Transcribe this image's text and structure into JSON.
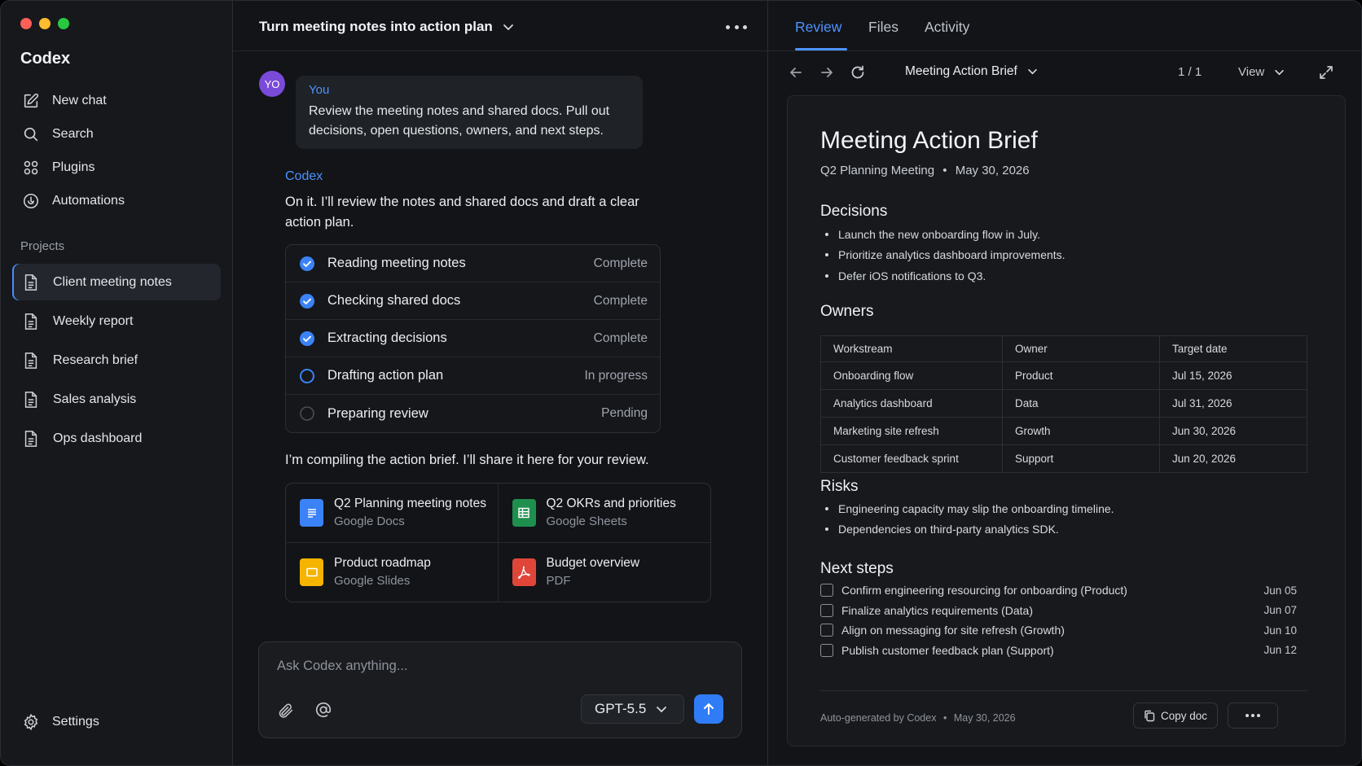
{
  "app": {
    "title": "Codex"
  },
  "sidebar": {
    "nav": [
      {
        "label": "New chat",
        "icon": "edit-icon"
      },
      {
        "label": "Search",
        "icon": "search-icon"
      },
      {
        "label": "Plugins",
        "icon": "plugins-icon"
      },
      {
        "label": "Automations",
        "icon": "automations-icon"
      }
    ],
    "projects_label": "Projects",
    "projects": [
      {
        "label": "Client meeting notes",
        "active": true
      },
      {
        "label": "Weekly report"
      },
      {
        "label": "Research brief"
      },
      {
        "label": "Sales analysis"
      },
      {
        "label": "Ops dashboard"
      }
    ],
    "settings_label": "Settings"
  },
  "chat": {
    "title": "Turn meeting notes into action plan",
    "user": {
      "avatar": "YO",
      "name": "You",
      "message": "Review the meeting notes and shared docs. Pull out decisions, open questions, owners, and next steps."
    },
    "assistant": {
      "name": "Codex",
      "message": "On it. I’ll review the notes and shared docs and draft a clear action plan.",
      "tasks": [
        {
          "label": "Reading meeting notes",
          "status": "Complete"
        },
        {
          "label": "Checking shared docs",
          "status": "Complete"
        },
        {
          "label": "Extracting decisions",
          "status": "Complete"
        },
        {
          "label": "Drafting action plan",
          "status": "In progress"
        },
        {
          "label": "Preparing review",
          "status": "Pending"
        }
      ],
      "followup": "I’m compiling the action brief. I’ll share it here for your review.",
      "attachments": [
        {
          "name": "Q2 Planning meeting notes",
          "source": "Google Docs",
          "color": "#3b82f6"
        },
        {
          "name": "Q2 OKRs and priorities",
          "source": "Google Sheets",
          "color": "#1f8f4e"
        },
        {
          "name": "Product roadmap",
          "source": "Google Slides",
          "color": "#f4b400"
        },
        {
          "name": "Budget overview",
          "source": "PDF",
          "color": "#e0453a"
        }
      ]
    },
    "composer": {
      "placeholder": "Ask Codex anything...",
      "model": "GPT-5.5"
    }
  },
  "panel": {
    "tabs": [
      "Review",
      "Files",
      "Activity"
    ],
    "active_tab": "Review",
    "doc_selector": "Meeting Action Brief",
    "pager": "1 / 1",
    "view_label": "View",
    "doc": {
      "title": "Meeting Action Brief",
      "subtitle_meeting": "Q2 Planning Meeting",
      "subtitle_date": "May 30, 2026",
      "decisions_heading": "Decisions",
      "decisions": [
        "Launch the new onboarding flow in July.",
        "Prioritize analytics dashboard improvements.",
        "Defer iOS notifications to Q3."
      ],
      "owners_heading": "Owners",
      "owners_columns": [
        "Workstream",
        "Owner",
        "Target date"
      ],
      "owners_rows": [
        [
          "Onboarding flow",
          "Product",
          "Jul 15, 2026"
        ],
        [
          "Analytics dashboard",
          "Data",
          "Jul 31, 2026"
        ],
        [
          "Marketing site refresh",
          "Growth",
          "Jun 30, 2026"
        ],
        [
          "Customer feedback sprint",
          "Support",
          "Jun 20, 2026"
        ]
      ],
      "risks_heading": "Risks",
      "risks": [
        "Engineering capacity may slip the onboarding timeline.",
        "Dependencies on third-party analytics SDK."
      ],
      "next_steps_heading": "Next steps",
      "next_steps": [
        {
          "label": "Confirm engineering resourcing for onboarding (Product)",
          "date": "Jun 05"
        },
        {
          "label": "Finalize analytics requirements (Data)",
          "date": "Jun 07"
        },
        {
          "label": "Align on messaging for site refresh (Growth)",
          "date": "Jun 10"
        },
        {
          "label": "Publish customer feedback plan (Support)",
          "date": "Jun 12"
        }
      ],
      "footer_source": "Auto-generated by Codex",
      "footer_date": "May 30, 2026",
      "copy_label": "Copy doc"
    }
  },
  "colors": {
    "accent": "#4d93ff",
    "send": "#2f7cf6",
    "avatar": "#7a4ad9"
  }
}
